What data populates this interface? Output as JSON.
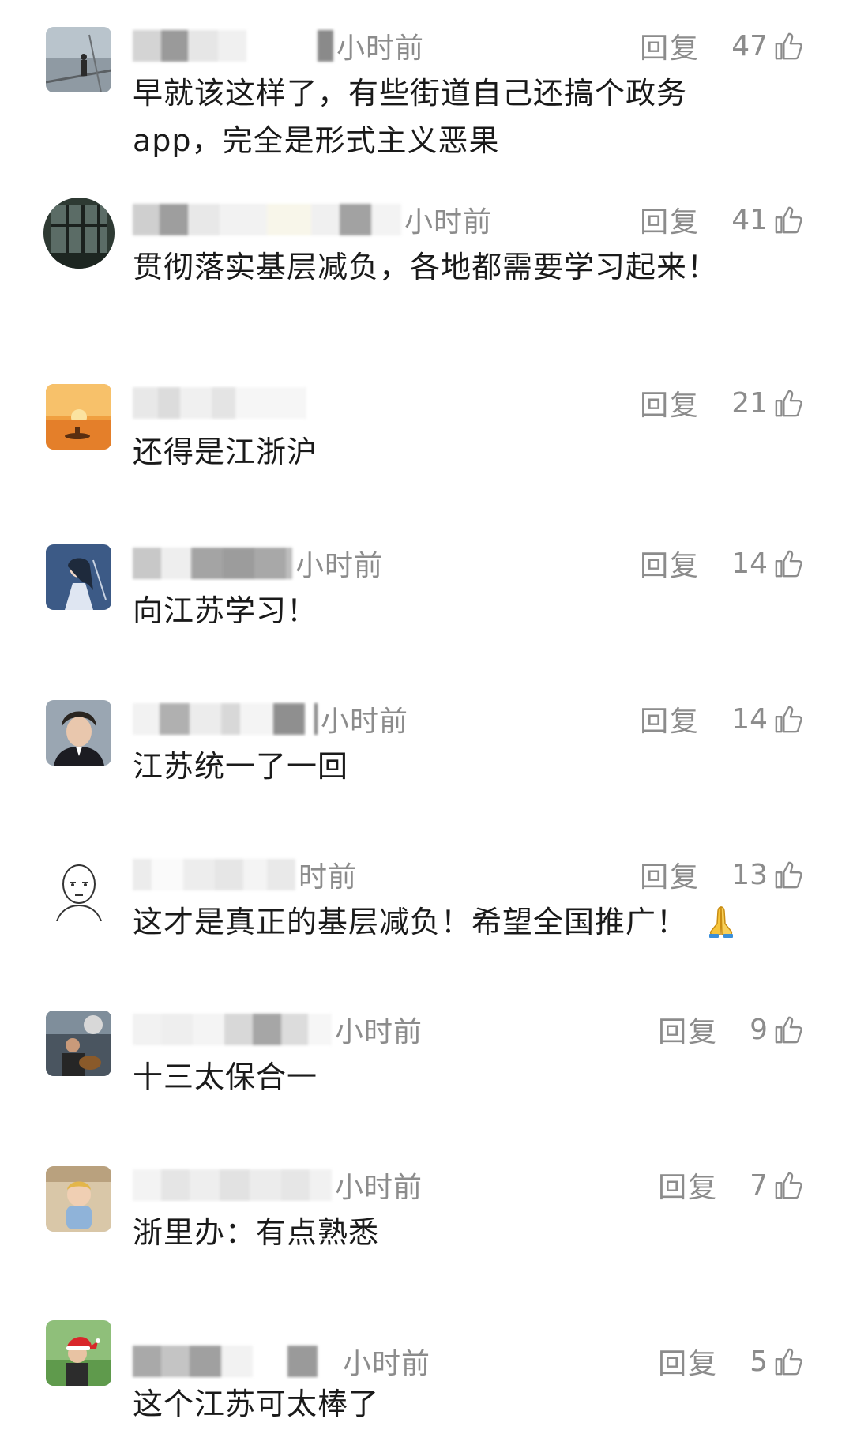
{
  "reply_label": "回复",
  "comments": [
    {
      "time": "小时前",
      "likes": "47",
      "text": "早就该这样了，有些街道自己还搞个政务app，完全是形式主义恶果",
      "avatar": "man-on-pier-avatar"
    },
    {
      "time": "小时前",
      "likes": "41",
      "text": "贯彻落实基层减负，各地都需要学习起来！",
      "avatar": "window-view-avatar"
    },
    {
      "time": "",
      "likes": "21",
      "text": "还得是江浙沪",
      "avatar": "sunset-boat-avatar"
    },
    {
      "time": "小时前",
      "likes": "14",
      "text": "向江苏学习！",
      "avatar": "anime-swordsman-avatar"
    },
    {
      "time": "小时前",
      "likes": "14",
      "text": "江苏统一了一回",
      "avatar": "anime-man-avatar"
    },
    {
      "time": "时前",
      "likes": "13",
      "text": "这才是真正的基层减负！希望全国推广！",
      "emoji": "folded-hands-emoji",
      "avatar": "saitama-avatar"
    },
    {
      "time": "小时前",
      "likes": "9",
      "text": "十三太保合一",
      "avatar": "man-with-guitar-avatar"
    },
    {
      "time": "小时前",
      "likes": "7",
      "text": "浙里办：有点熟悉",
      "avatar": "baby-avatar"
    },
    {
      "time": "小时前",
      "likes": "5",
      "text": "这个江苏可太棒了",
      "avatar": "santa-hat-avatar"
    }
  ],
  "colors": {
    "meta_gray": "#8c8c8c",
    "text": "#1a1a1a",
    "background": "#ffffff"
  }
}
